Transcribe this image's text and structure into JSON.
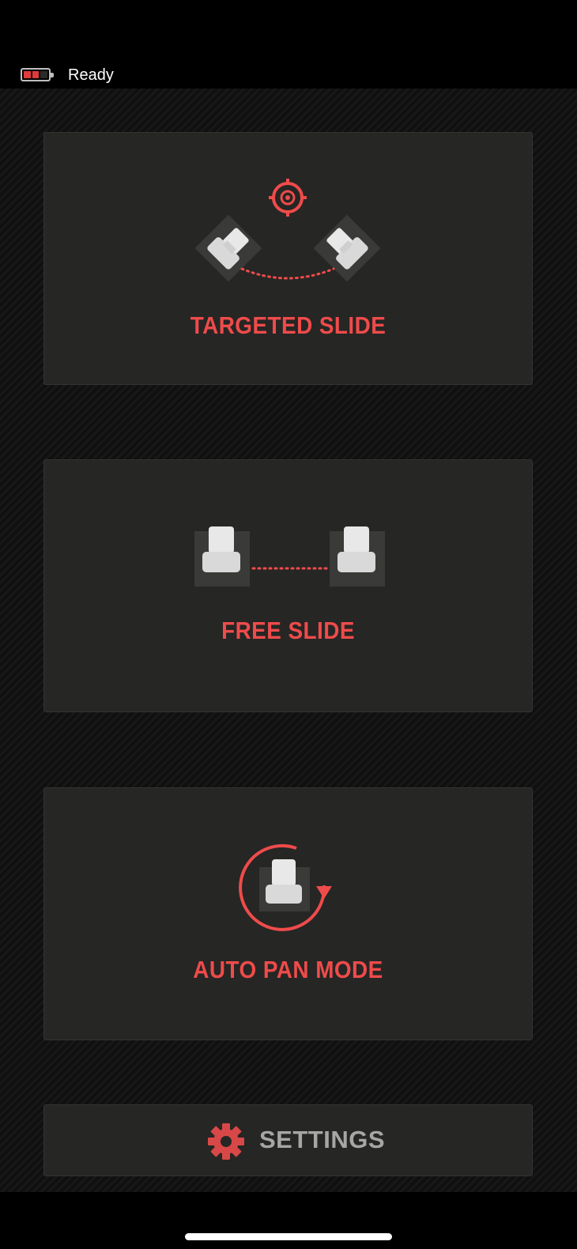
{
  "status": {
    "battery_icon": "battery-low-icon",
    "battery_color": "#e23a3a",
    "text": "Ready"
  },
  "modes": [
    {
      "label": "TARGETED SLIDE",
      "icon": "targeted-slide-icon"
    },
    {
      "label": "FREE SLIDE",
      "icon": "free-slide-icon"
    },
    {
      "label": "AUTO PAN MODE",
      "icon": "auto-pan-icon"
    }
  ],
  "settings": {
    "label": "SETTINGS",
    "icon": "gear-icon"
  },
  "colors": {
    "accent": "#ef4b4b",
    "card_bg": "#262624",
    "settings_text": "#a6a6a6"
  }
}
